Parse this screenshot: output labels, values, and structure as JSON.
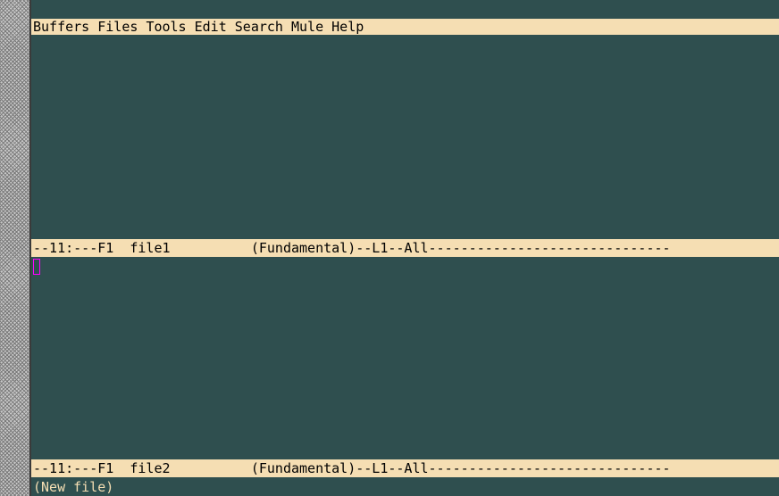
{
  "menubar": {
    "items": [
      "Buffers",
      "Files",
      "Tools",
      "Edit",
      "Search",
      "Mule",
      "Help"
    ]
  },
  "windows": [
    {
      "buffer_name": "file1",
      "modeline": "--11:---F1  file1          (Fundamental)--L1--All------------------------------"
    },
    {
      "buffer_name": "file2",
      "modeline": "--11:---F1  file2          (Fundamental)--L1--All------------------------------"
    }
  ],
  "minibuffer": {
    "message": "(New file)"
  },
  "colors": {
    "background": "#2f4f4f",
    "foreground": "#f5deb3",
    "menubar_bg": "#f5deb3",
    "modeline_bg": "#f5deb3",
    "cursor": "#ff00ff"
  }
}
